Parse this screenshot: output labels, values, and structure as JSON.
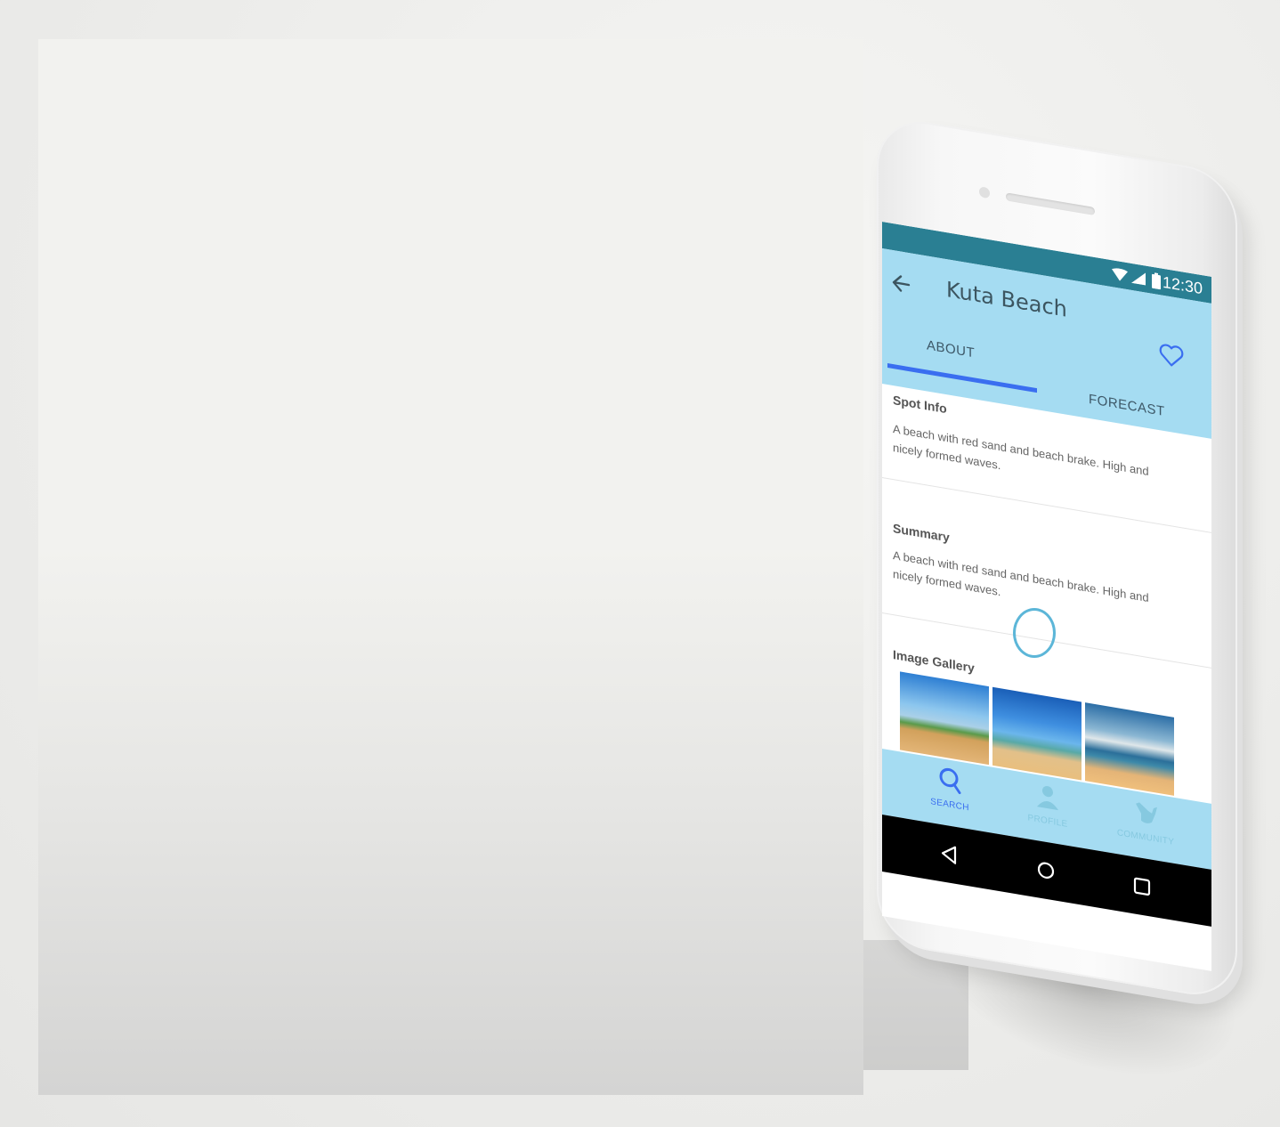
{
  "status_bar": {
    "time": "12:30"
  },
  "app_bar": {
    "title": "Kuta Beach"
  },
  "tabs": [
    {
      "label": "ABOUT",
      "selected": true
    },
    {
      "label": "FORECAST",
      "selected": false
    }
  ],
  "sections": [
    {
      "title": "Spot Info",
      "text": "A beach with red sand and beach brake. High and nicely formed waves."
    },
    {
      "title": "Summary",
      "text": "A beach with red sand and beach brake. High and nicely formed waves."
    },
    {
      "title": "Image Gallery"
    }
  ],
  "bottom_nav": [
    {
      "label": "SEARCH",
      "icon": "search-icon",
      "active": true
    },
    {
      "label": "PROFILE",
      "icon": "person-icon",
      "active": false
    },
    {
      "label": "COMMUNITY",
      "icon": "shaka-hand-icon",
      "active": false
    }
  ],
  "colors": {
    "status_bar": "#2a7f93",
    "app_bar": "#a5dcf2",
    "accent": "#3a6ef0",
    "touch_indicator": "#5cb6d8"
  }
}
